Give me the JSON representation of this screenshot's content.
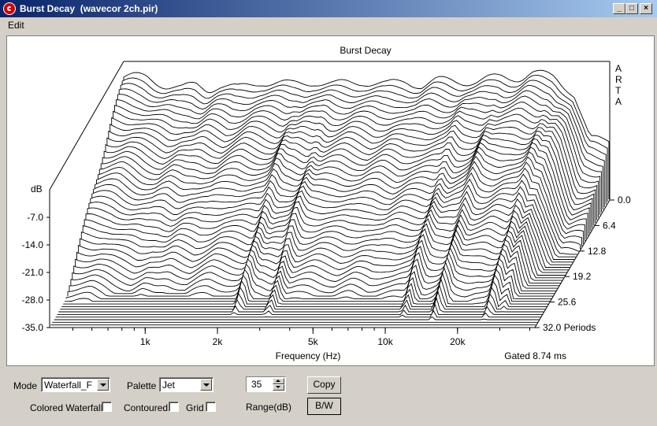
{
  "window": {
    "title": "Burst Decay  (wavecor 2ch.pir)",
    "buttons": [
      "_",
      "□",
      "×"
    ]
  },
  "menu": {
    "items": [
      "Edit"
    ]
  },
  "chart": {
    "title": "Burst Decay",
    "brand_vertical": [
      "A",
      "R",
      "T",
      "A"
    ],
    "y_unit": "dB",
    "y_ticks": [
      "-7.0",
      "-14.0",
      "-21.0",
      "-28.0",
      "-35.0"
    ],
    "z_ticks": [
      "0.0",
      "6.4",
      "12.8",
      "19.2",
      "25.6",
      "32.0 Periods"
    ],
    "x_ticks": [
      "1k",
      "2k",
      "5k",
      "10k",
      "20k"
    ],
    "xlabel": "Frequency (Hz)",
    "gated_text": "Gated 8.74 ms"
  },
  "chart_data": {
    "type": "waterfall",
    "title": "Burst Decay",
    "xlabel": "Frequency (Hz)",
    "ylabel": "dB",
    "zlabel": "Periods",
    "x_scale": "log",
    "y_range": [
      -35.0,
      0.0
    ],
    "z_range": [
      0.0,
      32.0
    ],
    "x_ticks": [
      1000,
      2000,
      5000,
      10000,
      20000
    ],
    "y_ticks": [
      -7.0,
      -14.0,
      -21.0,
      -28.0,
      -35.0
    ],
    "z_ticks": [
      0.0,
      6.4,
      12.8,
      19.2,
      25.6,
      32.0
    ],
    "slice_count": 50,
    "front_slice_db": [
      [
        500,
        -4
      ],
      [
        600,
        -6
      ],
      [
        700,
        -7
      ],
      [
        800,
        -6
      ],
      [
        900,
        -7
      ],
      [
        1000,
        -6
      ],
      [
        1200,
        -7
      ],
      [
        1500,
        -5
      ],
      [
        2000,
        -6
      ],
      [
        2500,
        -5
      ],
      [
        3000,
        -6
      ],
      [
        4000,
        -5
      ],
      [
        5000,
        -6
      ],
      [
        6000,
        -5
      ],
      [
        7000,
        -6
      ],
      [
        8000,
        -5
      ],
      [
        10000,
        -5
      ],
      [
        12000,
        -5
      ],
      [
        15000,
        -4
      ],
      [
        18000,
        -4
      ],
      [
        20000,
        -3
      ],
      [
        25000,
        -4
      ],
      [
        30000,
        -8
      ],
      [
        35000,
        -20
      ]
    ],
    "resonance_ridges_hz": [
      2200,
      3000,
      11000,
      15000,
      25000,
      28000
    ],
    "annotation": "Gated 8.74 ms"
  },
  "controls": {
    "mode_label": "Mode",
    "mode_value": "Waterfall_F",
    "palette_label": "Palette",
    "palette_value": "Jet",
    "range_value": "35",
    "range_label": "Range(dB)",
    "copy_label": "Copy",
    "bw_label": "B/W",
    "colored_label": "Colored Waterfall",
    "contoured_label": "Contoured",
    "grid_label": "Grid"
  }
}
